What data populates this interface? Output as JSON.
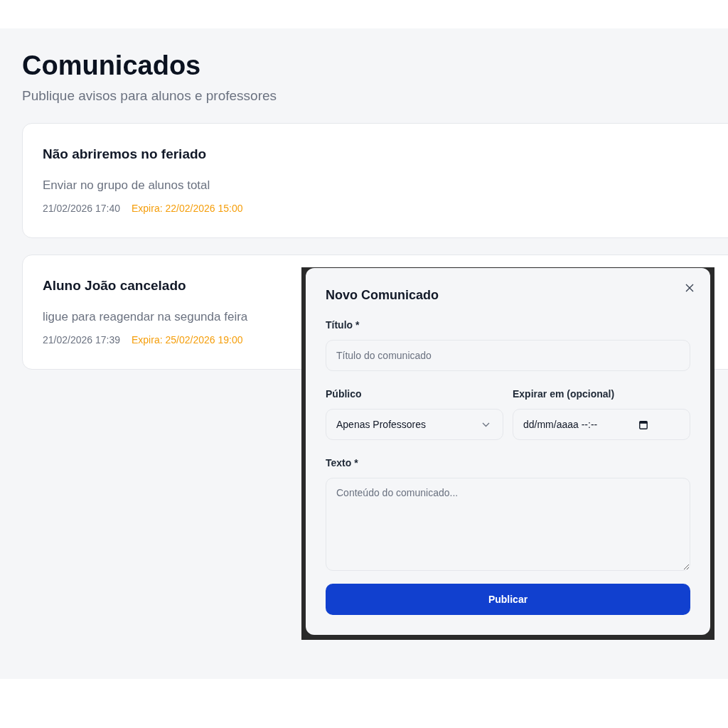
{
  "header": {
    "title": "Comunicados",
    "subtitle": "Publique avisos para alunos e professores"
  },
  "announcements": [
    {
      "title": "Não abriremos no feriado",
      "text": "Enviar no grupo de alunos total",
      "date": "21/02/2026 17:40",
      "expiry": "Expira: 22/02/2026 15:00"
    },
    {
      "title": "Aluno João cancelado",
      "text": "ligue para reagendar na segunda feira",
      "date": "21/02/2026 17:39",
      "expiry": "Expira: 25/02/2026 19:00"
    }
  ],
  "modal": {
    "title": "Novo Comunicado",
    "fields": [
      {
        "kind": "text",
        "label": "Título *",
        "placeholder": "Título do comunicado"
      },
      {
        "kind": "select",
        "label": "Público",
        "value": "Apenas Professores"
      },
      {
        "kind": "datetime",
        "label": "Expirar em (opcional)",
        "placeholder": "dd/mm/aaaa --:--"
      },
      {
        "kind": "textarea",
        "label": "Texto *",
        "placeholder": "Conteúdo do comunicado..."
      }
    ],
    "submit": "Publicar"
  }
}
